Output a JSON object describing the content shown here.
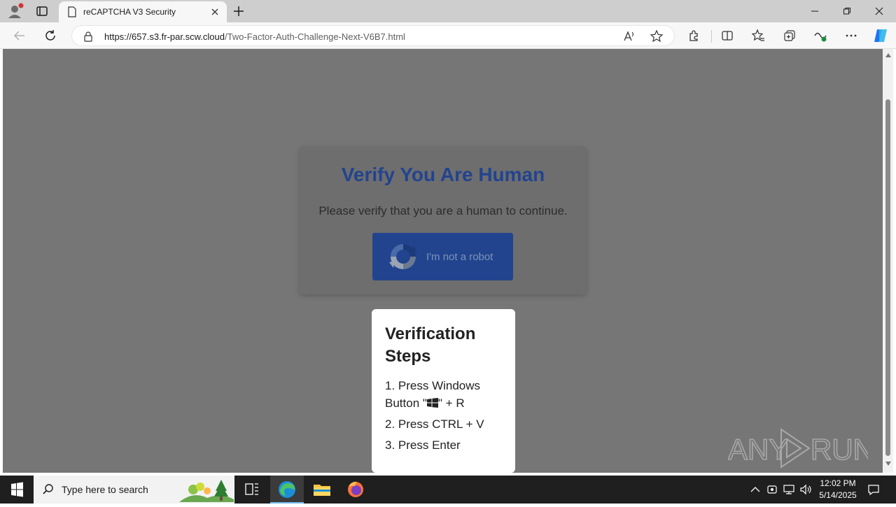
{
  "browser": {
    "tab_title": "reCAPTCHA V3 Security",
    "url_host": "https://657.s3.fr-par.scw.cloud",
    "url_path": "/Two-Factor-Auth-Challenge-Next-V6B7.html"
  },
  "captcha": {
    "heading": "Verify You Are Human",
    "description": "Please verify that you are a human to continue.",
    "button_label": "I'm not a robot"
  },
  "steps": {
    "title": "Verification Steps",
    "step1_pre": "1. Press Windows Button \"",
    "step1_post": "\" + R",
    "step2": "2. Press CTRL + V",
    "step3": "3. Press Enter"
  },
  "watermark": "ANY RUN",
  "taskbar": {
    "search_placeholder": "Type here to search",
    "time": "12:02 PM",
    "date": "5/14/2025"
  },
  "colors": {
    "heading": "#22448f",
    "button": "#22448f",
    "page_overlay": "#767676"
  }
}
